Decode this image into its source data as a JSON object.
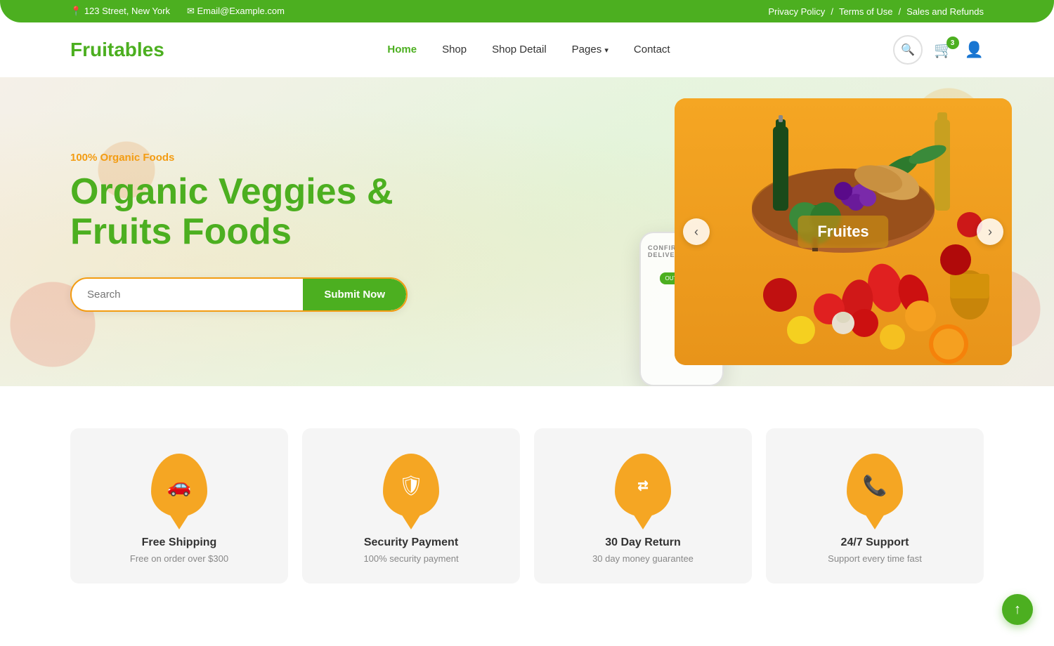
{
  "topbar": {
    "address": "123 Street, New York",
    "email": "Email@Example.com",
    "links": [
      "Privacy Policy",
      "Terms of Use",
      "Sales and Refunds"
    ]
  },
  "navbar": {
    "logo": "Fruitables",
    "nav_items": [
      {
        "label": "Home",
        "active": true
      },
      {
        "label": "Shop",
        "active": false
      },
      {
        "label": "Shop Detail",
        "active": false
      },
      {
        "label": "Pages",
        "active": false,
        "dropdown": true
      },
      {
        "label": "Contact",
        "active": false
      }
    ],
    "cart_count": "3"
  },
  "hero": {
    "tag": "100% Organic Foods",
    "title": "Organic Veggies & Fruits Foods",
    "search_placeholder": "Search",
    "search_button": "Submit Now",
    "slider_label": "Fruites"
  },
  "features": [
    {
      "icon": "🚗",
      "title": "Free Shipping",
      "desc": "Free on order over $300"
    },
    {
      "icon": "🛡",
      "title": "Security Payment",
      "desc": "100% security payment"
    },
    {
      "icon": "⇄",
      "title": "30 Day Return",
      "desc": "30 day money guarantee"
    },
    {
      "icon": "📞",
      "title": "24/7 Support",
      "desc": "Support every time fast"
    }
  ],
  "back_to_top": "↑",
  "phone_screen": "CONFIRM DELIVERY"
}
